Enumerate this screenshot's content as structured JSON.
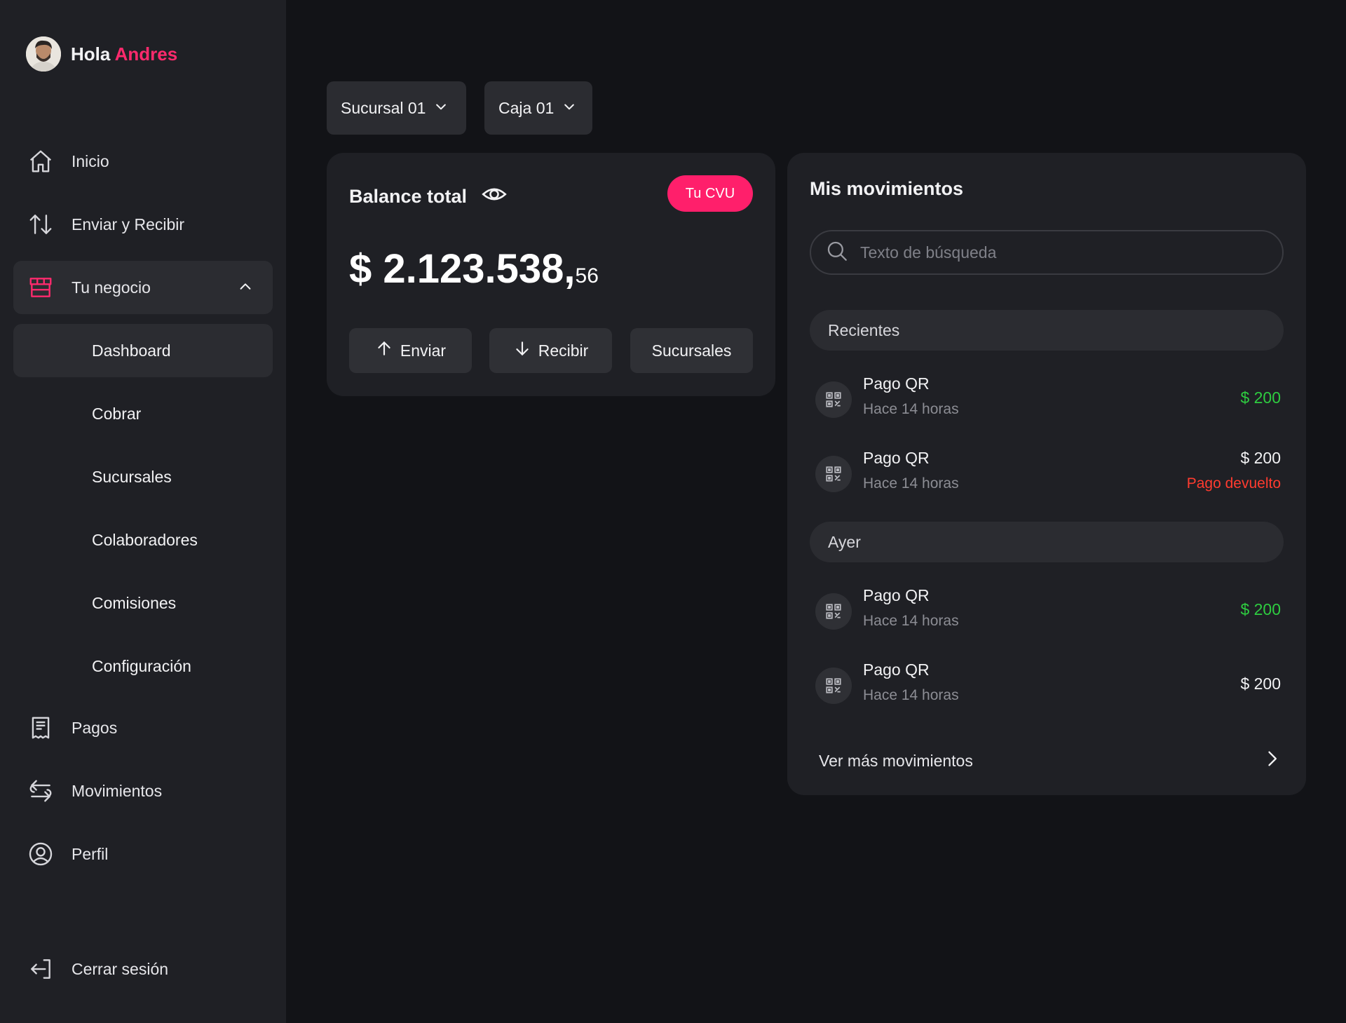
{
  "user": {
    "greeting": "Hola",
    "name": "Andres"
  },
  "colors": {
    "accent": "#ff1f6b",
    "positive": "#2ecc40",
    "negative": "#ff3b2f"
  },
  "sidebar": {
    "items": [
      {
        "label": "Inicio",
        "icon": "home-icon"
      },
      {
        "label": "Enviar y Recibir",
        "icon": "transfer-arrows-icon"
      },
      {
        "label": "Tu negocio",
        "icon": "store-icon",
        "expanded": true
      },
      {
        "label": "Pagos",
        "icon": "receipt-icon"
      },
      {
        "label": "Movimientos",
        "icon": "swap-icon"
      },
      {
        "label": "Perfil",
        "icon": "user-circle-icon"
      }
    ],
    "sub_items": [
      "Dashboard",
      "Cobrar",
      "Sucursales",
      "Colaboradores",
      "Comisiones",
      "Configuración"
    ],
    "active_sub": "Dashboard",
    "logout": "Cerrar sesión"
  },
  "filters": {
    "branch": "Sucursal 01",
    "register": "Caja 01"
  },
  "balance": {
    "title": "Balance total",
    "cvu_button": "Tu CVU",
    "amount_main": "$ 2.123.538,",
    "amount_cents": "56",
    "actions": [
      "Enviar",
      "Recibir",
      "Sucursales"
    ]
  },
  "movements": {
    "title": "Mis movimientos",
    "search_placeholder": "Texto de búsqueda",
    "groups": [
      {
        "label": "Recientes",
        "items": [
          {
            "title": "Pago QR",
            "time": "Hace 14 horas",
            "amount": "$ 200",
            "status": ""
          },
          {
            "title": "Pago QR",
            "time": "Hace 14 horas",
            "amount": "$ 200",
            "status": "Pago devuelto"
          }
        ]
      },
      {
        "label": "Ayer",
        "items": [
          {
            "title": "Pago QR",
            "time": "Hace 14 horas",
            "amount": "$ 200",
            "status": ""
          },
          {
            "title": "Pago QR",
            "time": "Hace 14 horas",
            "amount": "$ 200",
            "status": ""
          }
        ]
      }
    ],
    "see_more": "Ver más movimientos"
  }
}
